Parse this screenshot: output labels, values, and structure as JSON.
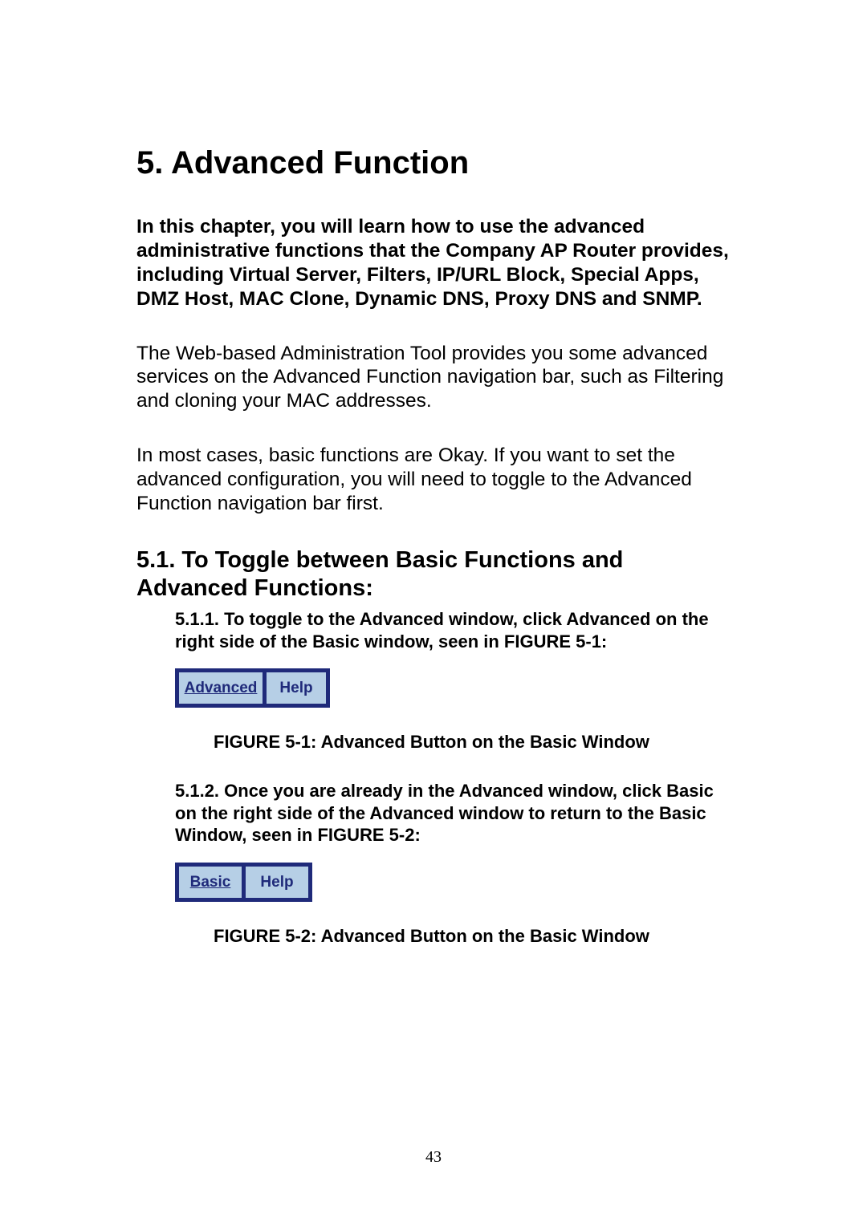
{
  "chapter": {
    "title": "5. Advanced Function",
    "intro_bold": "In this chapter, you will learn how to use the advanced administrative functions that the Company AP Router provides, including Virtual Server, Filters, IP/URL Block, Special Apps, DMZ Host, MAC Clone, Dynamic DNS, Proxy DNS and SNMP.",
    "para1": "The Web-based Administration Tool provides you some advanced services on the Advanced Function navigation bar, such as Filtering and cloning your MAC addresses.",
    "para2": "In most cases, basic functions are Okay. If you want to set the advanced configuration, you will need to toggle to the Advanced Function navigation bar first."
  },
  "section": {
    "title": "5.1. To Toggle between Basic Functions and Advanced Functions:",
    "step1": "5.1.1. To toggle to the Advanced window, click Advanced on the right side of the Basic window, seen in FIGURE 5-1:",
    "step2": "5.1.2. Once you are already in the Advanced window, click Basic on the right side of the Advanced window to return to the Basic Window, seen in FIGURE 5-2:"
  },
  "figure1": {
    "button_link": "Advanced",
    "button_plain": "Help",
    "caption": "FIGURE 5-1: Advanced Button on the Basic Window"
  },
  "figure2": {
    "button_link": "Basic",
    "button_plain": "Help",
    "caption": "FIGURE 5-2: Advanced Button on the Basic Window"
  },
  "page_number": "43"
}
